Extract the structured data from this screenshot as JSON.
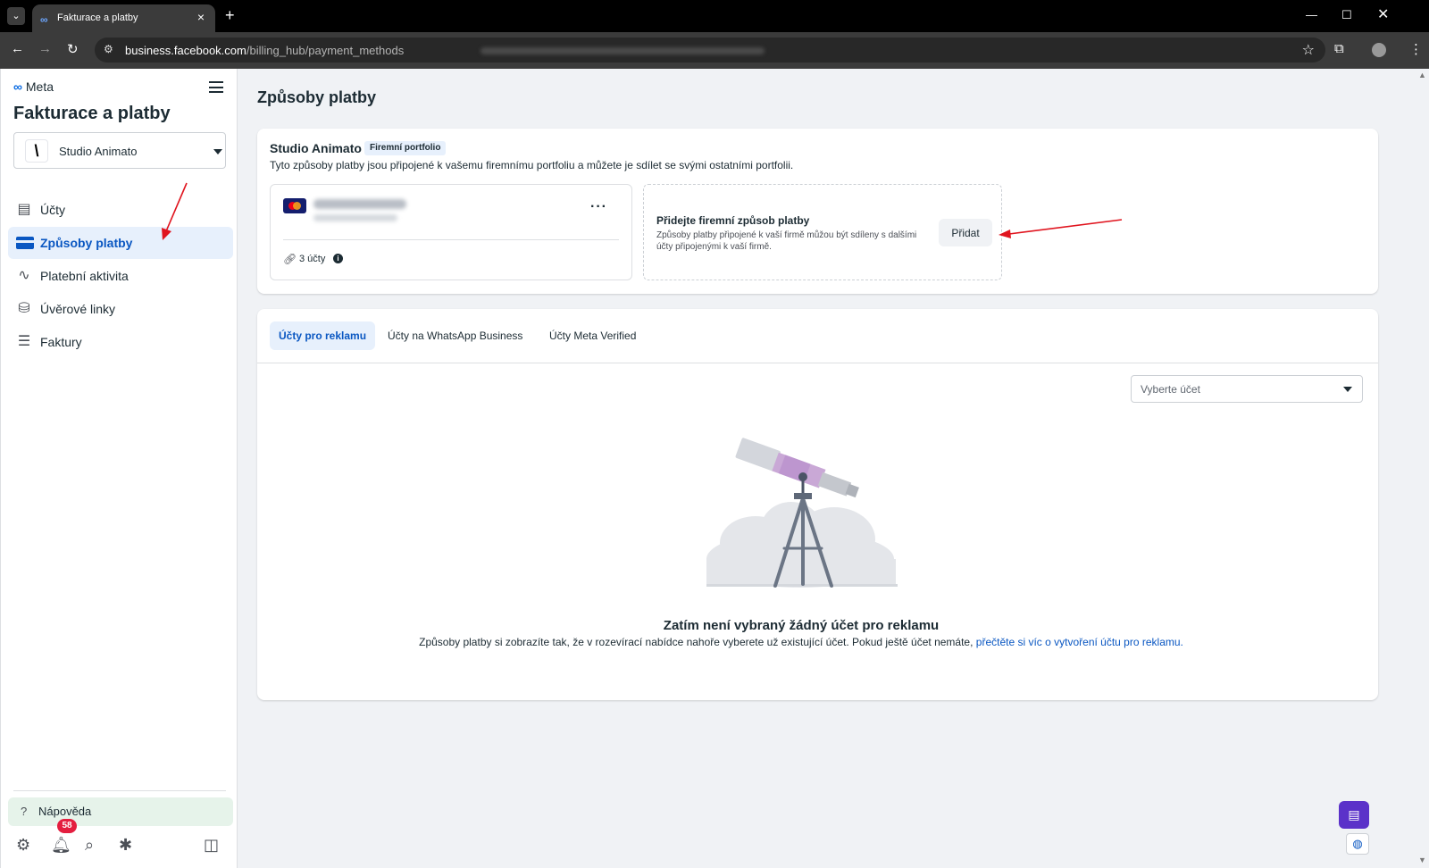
{
  "browser": {
    "tab_title": "Fakturace a platby",
    "url_domain": "business.facebook.com",
    "url_path": "/billing_hub/payment_methods"
  },
  "sidebar": {
    "brand": "Meta",
    "title": "Fakturace a platby",
    "business_name": "Studio Animato",
    "items": [
      {
        "label": "Účty",
        "icon": "accounts-icon"
      },
      {
        "label": "Způsoby platby",
        "icon": "credit-card-icon",
        "active": true
      },
      {
        "label": "Platební aktivita",
        "icon": "activity-icon"
      },
      {
        "label": "Úvěrové linky",
        "icon": "credit-line-icon"
      },
      {
        "label": "Faktury",
        "icon": "invoice-icon"
      }
    ],
    "help_label": "Nápověda",
    "notifications_count": "58"
  },
  "main": {
    "page_title": "Způsoby platby",
    "portfolio": {
      "name": "Studio Animato",
      "chip": "Firemní portfolio",
      "description": "Tyto způsoby platby jsou připojené k vašemu firemnímu portfoliu a můžete je sdílet se svými ostatními portfolii.",
      "payment_method": {
        "brand_icon": "mastercard-icon",
        "more_label": "···",
        "accounts_label": "3 účty"
      },
      "add": {
        "title": "Přidejte firemní způsob platby",
        "description": "Způsoby platby připojené k vaší firmě můžou být sdíleny s dalšími účty připojenými k vaší firmě.",
        "button": "Přidat"
      }
    },
    "tabs": [
      "Účty pro reklamu",
      "Účty na WhatsApp Business",
      "Účty Meta Verified"
    ],
    "account_select_placeholder": "Vyberte účet",
    "empty_state": {
      "title": "Zatím není vybraný žádný účet pro reklamu",
      "description": "Způsoby platby si zobrazíte tak, že v rozevírací nabídce nahoře vyberete už existující účet. Pokud ještě účet nemáte, ",
      "link": "přečtěte si víc o vytvoření účtu pro reklamu."
    }
  },
  "colors": {
    "accent": "#0a57c2",
    "active_bg": "#e7f0fc",
    "help_bg": "#e6f3ea",
    "annotation_arrow": "#e0141e",
    "chat_button": "#5b32c9"
  }
}
